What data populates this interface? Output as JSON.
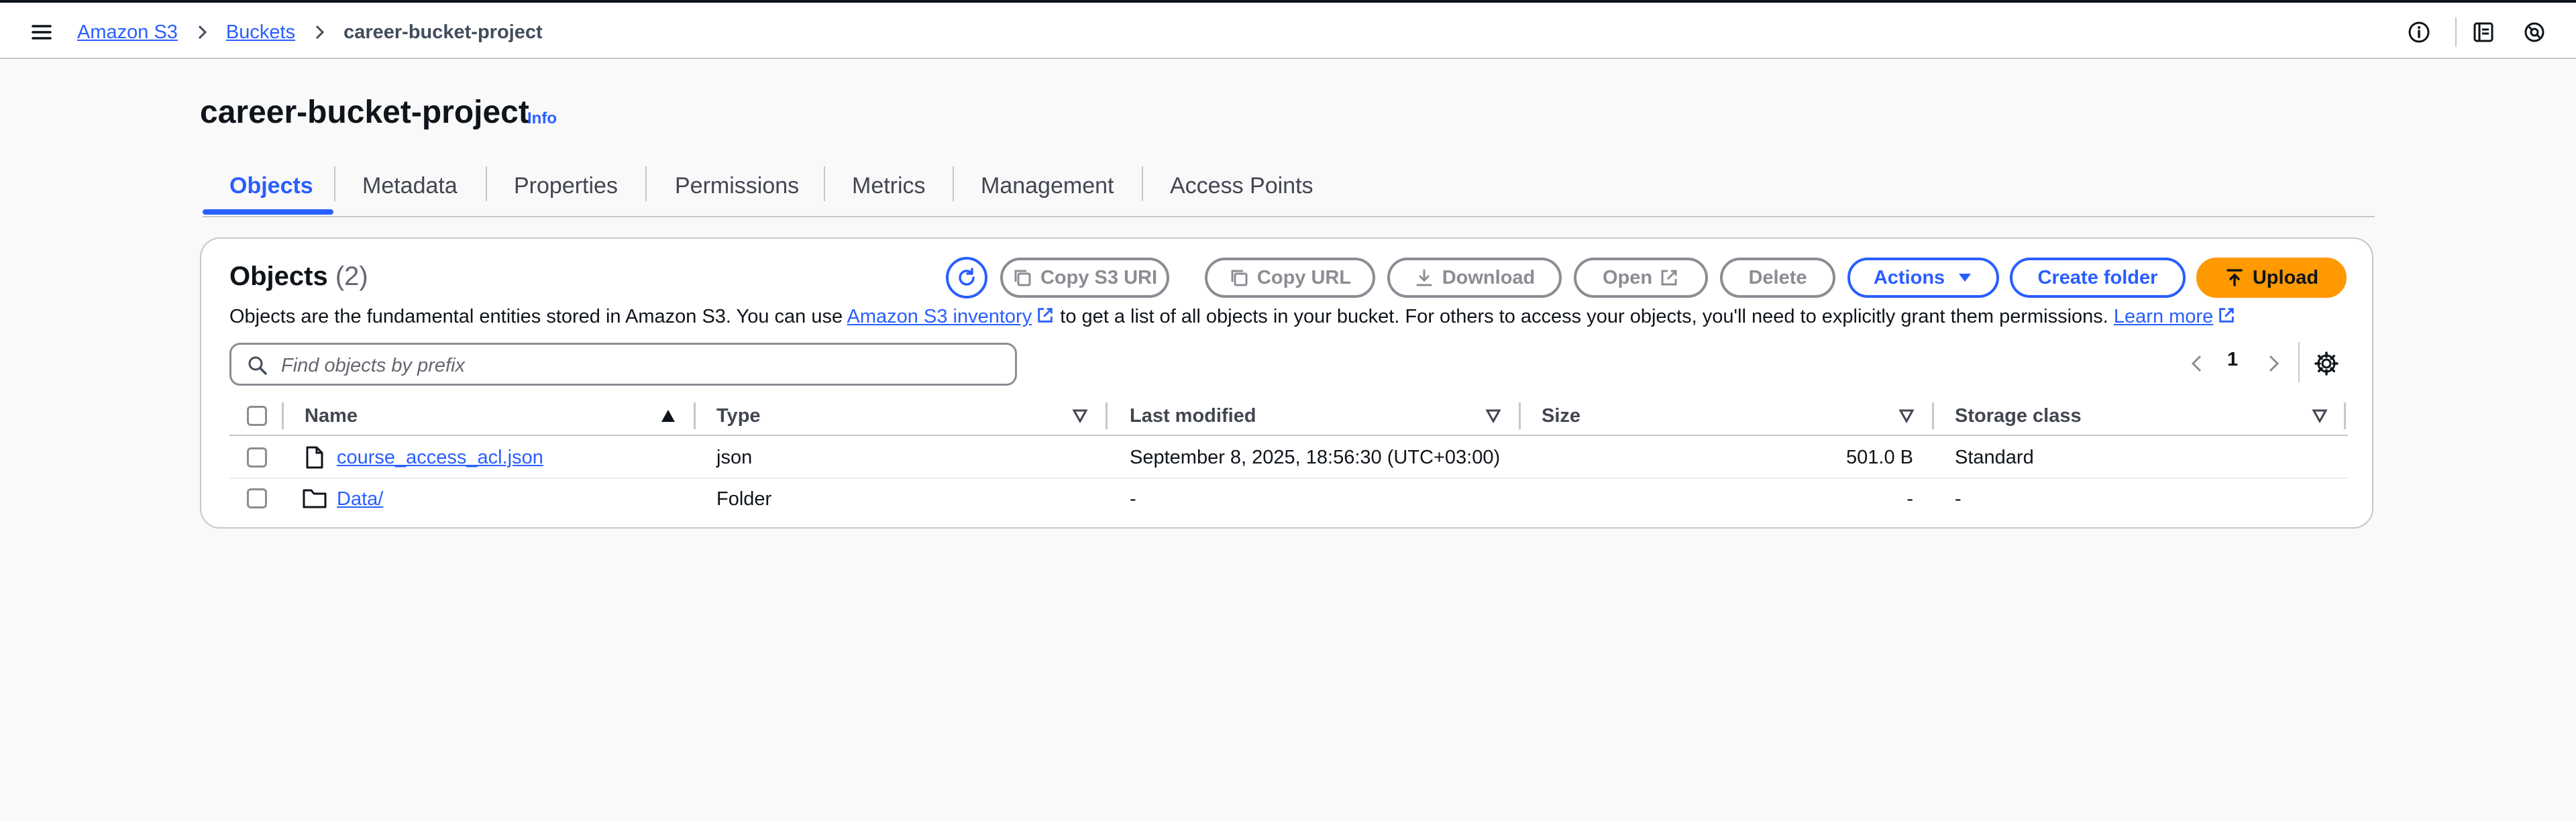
{
  "breadcrumb": {
    "root": "Amazon S3",
    "parent": "Buckets",
    "current": "career-bucket-project"
  },
  "header": {
    "title": "career-bucket-project",
    "info": "Info"
  },
  "tabs": [
    "Objects",
    "Metadata",
    "Properties",
    "Permissions",
    "Metrics",
    "Management",
    "Access Points"
  ],
  "objects_panel": {
    "title": "Objects",
    "count": "(2)",
    "buttons": {
      "copy_s3_uri": "Copy S3 URI",
      "copy_url": "Copy URL",
      "download": "Download",
      "open": "Open",
      "delete": "Delete",
      "actions": "Actions",
      "create_folder": "Create folder",
      "upload": "Upload"
    },
    "description": {
      "part1": "Objects are the fundamental entities stored in Amazon S3. You can use ",
      "link1": "Amazon S3 inventory",
      "part2": " to get a list of all objects in your bucket. For others to access your objects, you'll need to explicitly grant them permissions. ",
      "link2": "Learn more"
    },
    "search_placeholder": "Find objects by prefix",
    "page": "1"
  },
  "table": {
    "columns": [
      "Name",
      "Type",
      "Last modified",
      "Size",
      "Storage class"
    ],
    "rows": [
      {
        "name": "course_access_acl.json",
        "icon": "file-icon",
        "type": "json",
        "last_modified": "September 8, 2025, 18:56:30 (UTC+03:00)",
        "size": "501.0 B",
        "storage_class": "Standard"
      },
      {
        "name": "Data/",
        "icon": "folder-icon",
        "type": "Folder",
        "last_modified": "-",
        "size": "-",
        "storage_class": "-"
      }
    ]
  },
  "colors": {
    "accent": "#295eff",
    "upload": "#ff9900",
    "disabled": "#8c8c94"
  }
}
